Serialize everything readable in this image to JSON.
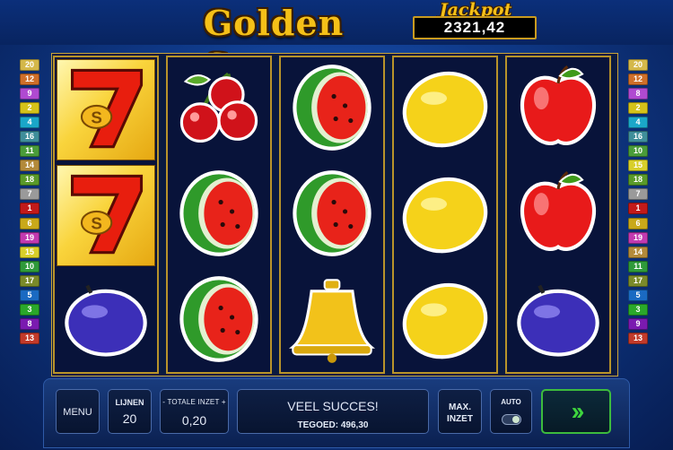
{
  "header": {
    "title": "Golden Sevens",
    "jackpot_label": "Jackpot",
    "jackpot_value": "2321,42"
  },
  "paylines": {
    "left": [
      {
        "n": "20",
        "color": "#d4b84a"
      },
      {
        "n": "12",
        "color": "#cf6f2a"
      },
      {
        "n": "9",
        "color": "#b04ad1"
      },
      {
        "n": "2",
        "color": "#d4c21a"
      },
      {
        "n": "4",
        "color": "#1aa7c9"
      },
      {
        "n": "16",
        "color": "#3f8e9a"
      },
      {
        "n": "11",
        "color": "#4a9c3a"
      },
      {
        "n": "14",
        "color": "#b38a3a"
      },
      {
        "n": "18",
        "color": "#5a9a2a"
      },
      {
        "n": "7",
        "color": "#9a9a9a"
      },
      {
        "n": "1",
        "color": "#c21a1a"
      },
      {
        "n": "6",
        "color": "#c9a91a"
      },
      {
        "n": "19",
        "color": "#c23ab0"
      },
      {
        "n": "15",
        "color": "#d8cf2a"
      },
      {
        "n": "10",
        "color": "#2f9a3a"
      },
      {
        "n": "17",
        "color": "#7a8a2a"
      },
      {
        "n": "5",
        "color": "#1a6ac2"
      },
      {
        "n": "3",
        "color": "#2aa82a"
      },
      {
        "n": "8",
        "color": "#7a1ab0"
      },
      {
        "n": "13",
        "color": "#c23a2a"
      }
    ],
    "right": [
      {
        "n": "20",
        "color": "#d4b84a"
      },
      {
        "n": "12",
        "color": "#cf6f2a"
      },
      {
        "n": "8",
        "color": "#b04ad1"
      },
      {
        "n": "2",
        "color": "#d4c21a"
      },
      {
        "n": "4",
        "color": "#1aa7c9"
      },
      {
        "n": "16",
        "color": "#3f8e9a"
      },
      {
        "n": "10",
        "color": "#4a9c3a"
      },
      {
        "n": "15",
        "color": "#d8cf2a"
      },
      {
        "n": "18",
        "color": "#5a9a2a"
      },
      {
        "n": "7",
        "color": "#9a9a9a"
      },
      {
        "n": "1",
        "color": "#c21a1a"
      },
      {
        "n": "6",
        "color": "#c9a91a"
      },
      {
        "n": "19",
        "color": "#c23ab0"
      },
      {
        "n": "14",
        "color": "#b38a3a"
      },
      {
        "n": "11",
        "color": "#2f9a3a"
      },
      {
        "n": "17",
        "color": "#7a8a2a"
      },
      {
        "n": "5",
        "color": "#1a6ac2"
      },
      {
        "n": "3",
        "color": "#2aa82a"
      },
      {
        "n": "9",
        "color": "#7a1ab0"
      },
      {
        "n": "13",
        "color": "#c23a2a"
      }
    ]
  },
  "reels": [
    [
      "seven",
      "seven",
      "plum"
    ],
    [
      "cherry",
      "watermelon",
      "watermelon"
    ],
    [
      "watermelon",
      "watermelon",
      "bell"
    ],
    [
      "lemon",
      "lemon",
      "lemon"
    ],
    [
      "apple",
      "apple",
      "plum"
    ]
  ],
  "controls": {
    "menu": "MENU",
    "lines_label": "LIJNEN",
    "lines_value": "20",
    "bet_label": "-  TOTALE INZET  +",
    "bet_value": "0,20",
    "message": "VEEL SUCCES!",
    "credit": "TEGOED: 496,30",
    "max_bet": "MAX. INZET",
    "auto": "AUTO",
    "spin_icon": "double-chevron-right-icon"
  }
}
